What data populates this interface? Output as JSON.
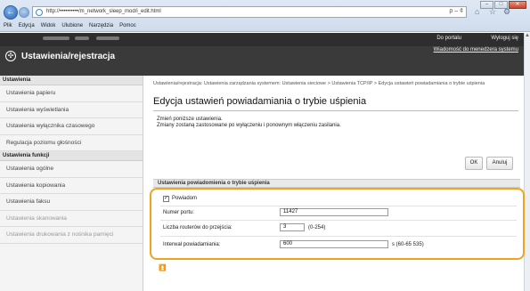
{
  "browser": {
    "back_icon": "arrow-left-icon",
    "address_url": "http://••••••••••/m_network_sleep_mod/i_edit.html",
    "address_tools": "ρ – ¢",
    "menu": [
      "Plik",
      "Edycja",
      "Widok",
      "Ulubione",
      "Narzędzia",
      "Pomoc"
    ]
  },
  "header": {
    "portal_link": "Do portalu",
    "logout_link": "Wyloguj się",
    "back_link": "Wiadomość do menedżera systemu",
    "app_title": "Ustawienia/rejestracja"
  },
  "sidebar": {
    "section1_title": "Ustawienia",
    "section1_items": [
      "Ustawienia papieru",
      "Ustawienia wyświetlania",
      "Ustawienia wyłącznika czasowego",
      "Regulacja poziomu głośności"
    ],
    "section2_title": "Ustawienia funkcji",
    "section2_items": [
      "Ustawienia ogólne",
      "Ustawienia kopiowania",
      "Ustawienia faksu",
      "Ustawienia skanowania",
      "Ustawienia drukowania z nośnika pamięci"
    ]
  },
  "main": {
    "breadcrumb": "Ustawienia/rejestracja: Ustawienia zarządzania systemem: Ustawienia sieciowe > Ustawienia TCP/IP > Edycja ustawień powiadamiania o trybie uśpienia",
    "page_title": "Edycja ustawień powiadamiania o trybie uśpienia",
    "note1": "Zmień poniższe ustawienia.",
    "note2": "Zmiany zostaną zastosowane po wyłączeniu i ponownym włączeniu zasilania.",
    "ok_label": "OK",
    "cancel_label": "Anuluj",
    "section_title": "Ustawienia powiadomienia o trybie uśpienia",
    "notify_label": "Powiadom",
    "notify_checked": "✓",
    "port_label": "Numer portu:",
    "port_value": "11427",
    "hops_label": "Liczba routerów do przejścia:",
    "hops_value": "3",
    "hops_range": "(0-254)",
    "interval_label": "Interwał powiadamiania:",
    "interval_value": "600",
    "interval_range": "s (60-65 535)",
    "top_icon": "⏫"
  },
  "colors": {
    "highlight": "#f2a31c",
    "header_bg": "#3a3a3a"
  }
}
